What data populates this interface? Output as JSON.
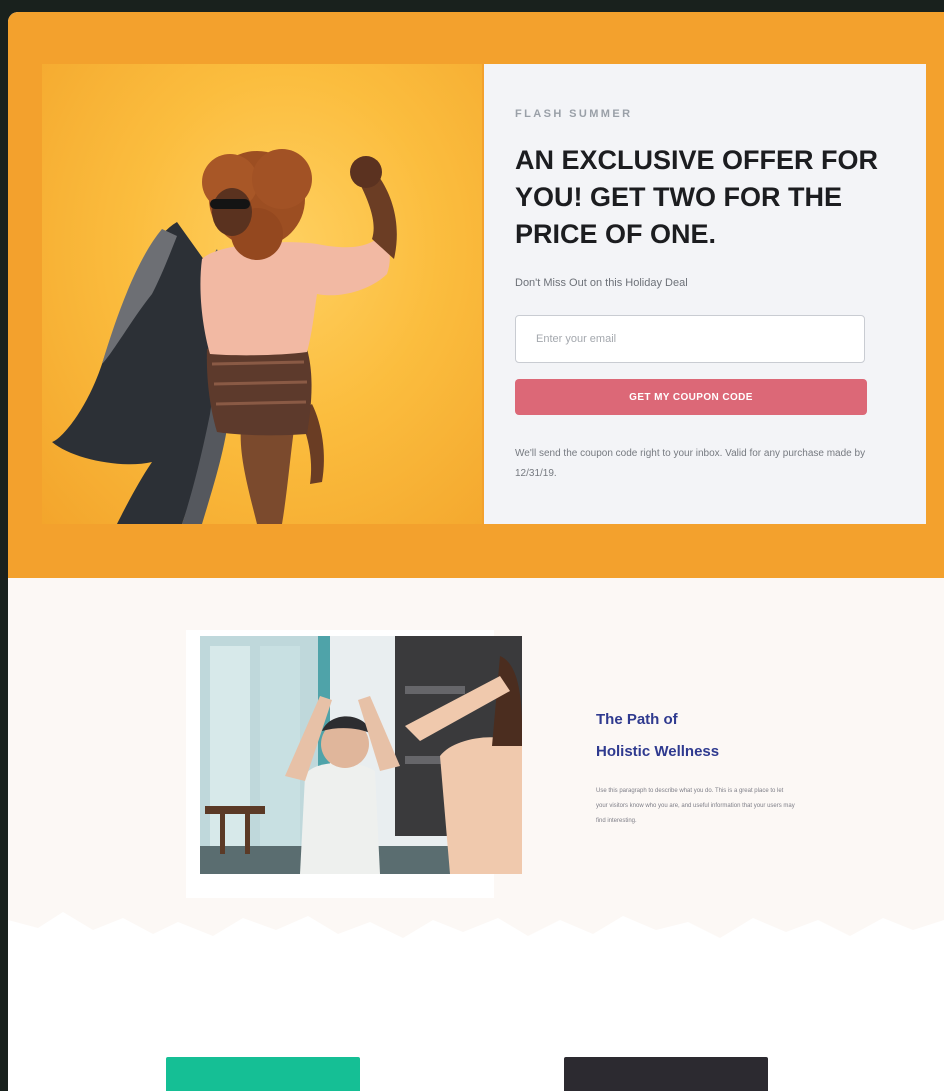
{
  "hero": {
    "background_color": "#f3a12d",
    "photo_alt": "",
    "offer": {
      "eyebrow": "FLASH SUMMER",
      "title": "AN EXCLUSIVE OFFER FOR YOU! GET TWO FOR THE PRICE OF ONE.",
      "subtitle": "Don't Miss Out on this Holiday Deal",
      "email_placeholder": "Enter your email",
      "button_label": "GET MY COUPON CODE",
      "button_color": "#dc6877",
      "note": "We'll send the coupon code right to your inbox. Valid for any purchase made by 12/31/19."
    }
  },
  "wellness": {
    "title_line_1": "The Path of",
    "title_line_2": "Holistic Wellness",
    "title_color": "#2f3a8f",
    "body": "Use this paragraph to describe what you do. This is a great place to let your visitors know who you are, and useful information that your users may find interesting."
  },
  "bottom_buttons": {
    "primary_color": "#15bf95",
    "secondary_color": "#2c2a30"
  }
}
